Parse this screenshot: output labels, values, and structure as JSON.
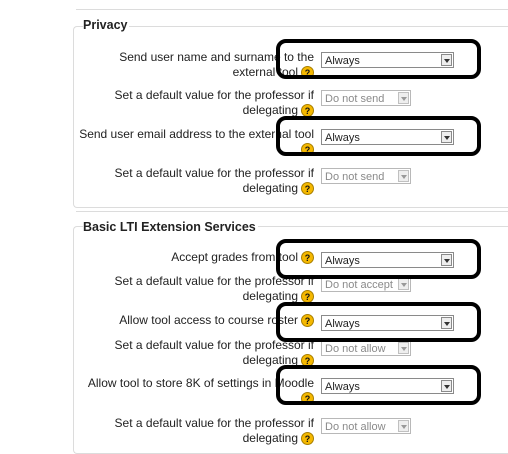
{
  "privacy": {
    "legend": "Privacy",
    "rows": [
      {
        "label": "Send user name and surname to the external tool",
        "value": "Always"
      },
      {
        "label": "Set a default value for the professor if delegating",
        "value": "Do not send"
      },
      {
        "label": "Send user email address to the external tool",
        "value": "Always"
      },
      {
        "label": "Set a default value for the professor if delegating",
        "value": "Do not send"
      }
    ]
  },
  "lti": {
    "legend": "Basic LTI Extension Services",
    "rows": [
      {
        "label": "Accept grades from tool",
        "value": "Always"
      },
      {
        "label": "Set a default value for the professor if delegating",
        "value": "Do not accept"
      },
      {
        "label": "Allow tool access to course roster",
        "value": "Always"
      },
      {
        "label": "Set a default value for the professor if delegating",
        "value": "Do not allow"
      },
      {
        "label": "Allow tool to store 8K of settings in Moodle",
        "value": "Always"
      },
      {
        "label": "Set a default value for the professor if delegating",
        "value": "Do not allow"
      }
    ]
  },
  "help_icon": {
    "glyph": "?",
    "color": "#f5b800"
  },
  "highlight_color": "#000000"
}
